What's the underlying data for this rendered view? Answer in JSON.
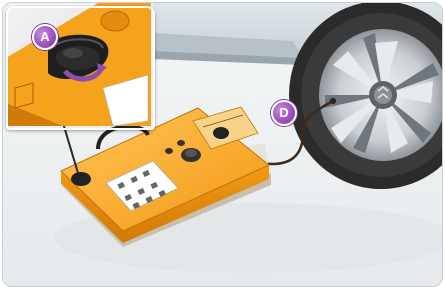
{
  "labels": {
    "a": "A",
    "d": "D"
  },
  "colors": {
    "badge": "#9a4fb8",
    "compressor_body": "#f5a21d",
    "tyre": "#2b2b2b",
    "background": "#eef1f2"
  }
}
